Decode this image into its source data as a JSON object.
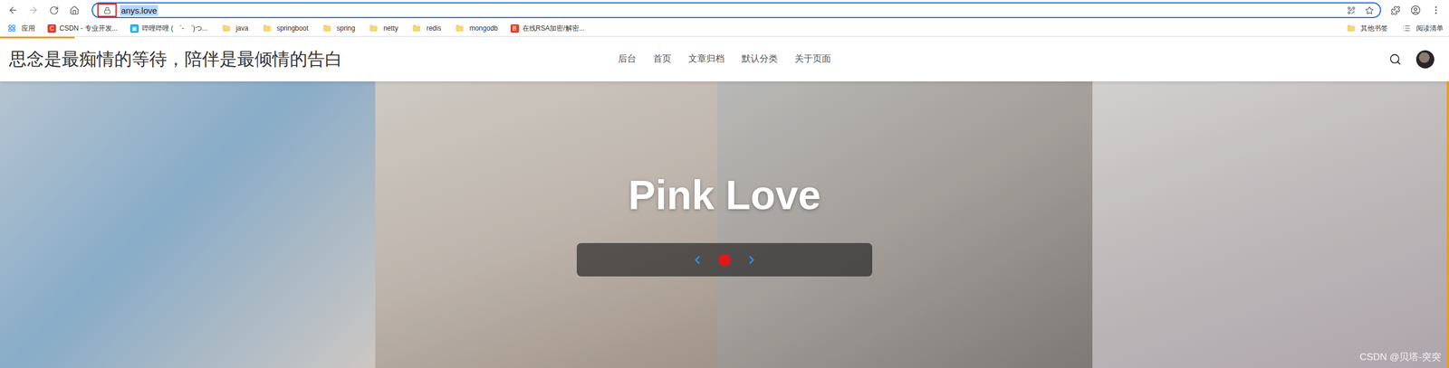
{
  "browser": {
    "address": "anys.love",
    "bookmarks": [
      {
        "label": "应用",
        "kind": "apps"
      },
      {
        "label": "CSDN - 专业开发...",
        "kind": "csdn"
      },
      {
        "label": "哔哩哔哩 ( ゜- ゜)つ...",
        "kind": "bili"
      },
      {
        "label": "java",
        "kind": "folder"
      },
      {
        "label": "springboot",
        "kind": "folder"
      },
      {
        "label": "spring",
        "kind": "folder"
      },
      {
        "label": "netty",
        "kind": "folder"
      },
      {
        "label": "redis",
        "kind": "folder"
      },
      {
        "label": "mongodb",
        "kind": "folder"
      },
      {
        "label": "在线RSA加密/解密...",
        "kind": "rsa"
      }
    ],
    "right_bookmarks": [
      {
        "label": "其他书签",
        "kind": "folder"
      },
      {
        "label": "阅读清单",
        "kind": "list"
      }
    ]
  },
  "site": {
    "title": "思念是最痴情的等待，陪伴是最倾情的告白",
    "nav": [
      "后台",
      "首页",
      "文章归档",
      "默认分类",
      "关于页面"
    ]
  },
  "hero": {
    "title": "Pink Love",
    "dots": [
      {
        "selected": true
      }
    ]
  },
  "watermark": "CSDN @贝塔-突突"
}
